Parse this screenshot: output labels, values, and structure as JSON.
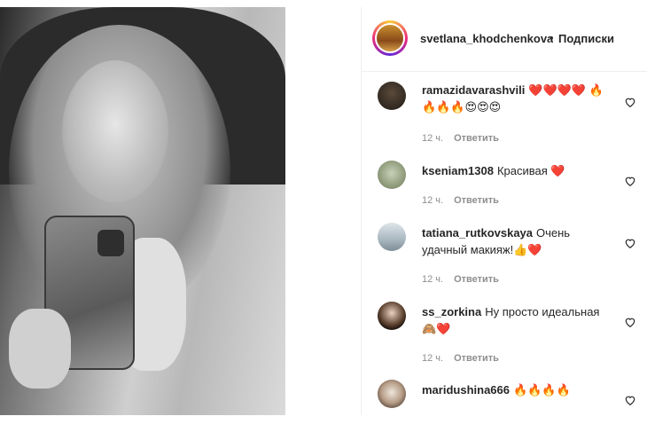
{
  "post": {
    "username": "svetlana_khodchenkova",
    "separator": "•",
    "follow_label": "Подписки"
  },
  "comments": [
    {
      "user": "ramazidavarashvili",
      "text": "❤️❤️❤️❤️ 🔥🔥🔥🔥😍😍😍",
      "time": "12 ч.",
      "reply": "Ответить"
    },
    {
      "user": "kseniam1308",
      "text": "Красивая ❤️",
      "time": "12 ч.",
      "reply": "Ответить"
    },
    {
      "user": "tatiana_rutkovskaya",
      "text": "Очень удачный макияж!👍❤️",
      "time": "12 ч.",
      "reply": "Ответить"
    },
    {
      "user": "ss_zorkina",
      "text": "Ну просто идеальная 🙈❤️",
      "time": "12 ч.",
      "reply": "Ответить"
    },
    {
      "user": "maridushina666",
      "text": "🔥🔥🔥🔥",
      "time": "",
      "reply": ""
    }
  ]
}
